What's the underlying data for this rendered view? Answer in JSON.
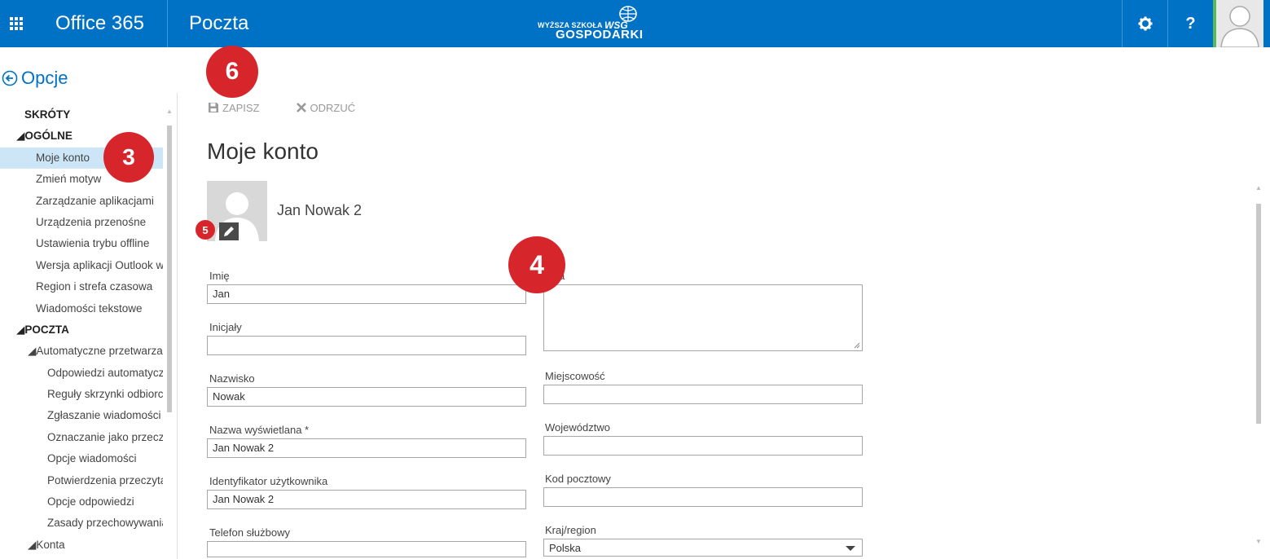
{
  "header": {
    "office_title": "Office 365",
    "app_title": "Poczta",
    "logo": {
      "small": "WYŻSZA SZKOŁA",
      "big": "GOSPODARKI",
      "mark": "WSG"
    },
    "help_label": "?",
    "accent_color": "#0072c6"
  },
  "sidebar": {
    "back_label": "Opcje",
    "items": [
      {
        "label": "SKRÓTY",
        "indent": 30,
        "section": true
      },
      {
        "label": "◢OGÓLNE",
        "indent": 20,
        "section": true
      },
      {
        "label": "Moje konto",
        "indent": 44,
        "selected": true
      },
      {
        "label": "Zmień motyw",
        "indent": 44
      },
      {
        "label": "Zarządzanie aplikacjami",
        "indent": 44
      },
      {
        "label": "Urządzenia przenośne",
        "indent": 44
      },
      {
        "label": "Ustawienia trybu offline",
        "indent": 44
      },
      {
        "label": "Wersja aplikacji Outlook w",
        "indent": 44
      },
      {
        "label": "Region i strefa czasowa",
        "indent": 44
      },
      {
        "label": "Wiadomości tekstowe",
        "indent": 44
      },
      {
        "label": "◢POCZTA",
        "indent": 20,
        "section": true
      },
      {
        "label": "◢Automatyczne przetwarzanie",
        "indent": 34
      },
      {
        "label": "Odpowiedzi automatyczne",
        "indent": 58
      },
      {
        "label": "Reguły skrzynki odbiorczej",
        "indent": 58
      },
      {
        "label": "Zgłaszanie wiadomości",
        "indent": 58
      },
      {
        "label": "Oznaczanie jako przeczytane",
        "indent": 58
      },
      {
        "label": "Opcje wiadomości",
        "indent": 58
      },
      {
        "label": "Potwierdzenia przeczytania",
        "indent": 58
      },
      {
        "label": "Opcje odpowiedzi",
        "indent": 58
      },
      {
        "label": "Zasady przechowywania",
        "indent": 58
      },
      {
        "label": "◢Konta",
        "indent": 34
      }
    ]
  },
  "toolbar": {
    "save_label": "ZAPISZ",
    "discard_label": "ODRZUĆ"
  },
  "page": {
    "title": "Moje konto",
    "display_name": "Jan Nowak 2"
  },
  "form": {
    "first_name": {
      "label": "Imię",
      "value": "Jan"
    },
    "initials": {
      "label": "Inicjały",
      "value": ""
    },
    "last_name": {
      "label": "Nazwisko",
      "value": "Nowak"
    },
    "display_name": {
      "label": "Nazwa wyświetlana *",
      "value": "Jan Nowak 2"
    },
    "user_id": {
      "label": "Identyfikator użytkownika",
      "value": "Jan Nowak 2"
    },
    "work_phone": {
      "label": "Telefon służbowy",
      "value": ""
    },
    "street": {
      "label": "a",
      "value": ""
    },
    "city": {
      "label": "Miejscowość",
      "value": ""
    },
    "state": {
      "label": "Województwo",
      "value": ""
    },
    "zip": {
      "label": "Kod pocztowy",
      "value": ""
    },
    "country": {
      "label": "Kraj/region",
      "value": "Polska"
    }
  },
  "callouts": {
    "c3": "3",
    "c4": "4",
    "c5": "5",
    "c6": "6",
    "color": "#d7262b"
  }
}
